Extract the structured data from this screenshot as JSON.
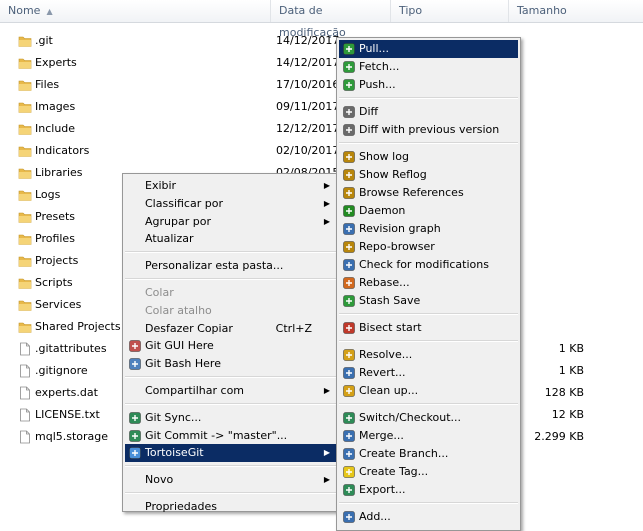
{
  "columns": {
    "name": "Nome",
    "date": "Data de modificação",
    "type": "Tipo",
    "size": "Tamanho"
  },
  "files": [
    {
      "name": ".git",
      "date": "14/12/2017",
      "type": "folder",
      "size": ""
    },
    {
      "name": "Experts",
      "date": "14/12/2017",
      "type": "folder",
      "size": ""
    },
    {
      "name": "Files",
      "date": "17/10/2016",
      "type": "folder",
      "size": ""
    },
    {
      "name": "Images",
      "date": "09/11/2017",
      "type": "folder",
      "size": ""
    },
    {
      "name": "Include",
      "date": "12/12/2017",
      "type": "folder",
      "size": ""
    },
    {
      "name": "Indicators",
      "date": "02/10/2017",
      "type": "folder",
      "size": ""
    },
    {
      "name": "Libraries",
      "date": "02/08/2015",
      "type": "folder",
      "size": ""
    },
    {
      "name": "Logs",
      "date": "",
      "type": "folder",
      "size": ""
    },
    {
      "name": "Presets",
      "date": "",
      "type": "folder",
      "size": ""
    },
    {
      "name": "Profiles",
      "date": "",
      "type": "folder",
      "size": ""
    },
    {
      "name": "Projects",
      "date": "",
      "type": "folder",
      "size": ""
    },
    {
      "name": "Scripts",
      "date": "",
      "type": "folder",
      "size": ""
    },
    {
      "name": "Services",
      "date": "",
      "type": "folder",
      "size": ""
    },
    {
      "name": "Shared Projects",
      "date": "",
      "type": "folder",
      "size": ""
    },
    {
      "name": ".gitattributes",
      "date": "",
      "type": "file",
      "size": "1 KB"
    },
    {
      "name": ".gitignore",
      "date": "",
      "type": "file",
      "size": "1 KB"
    },
    {
      "name": "experts.dat",
      "date": "",
      "type": "file",
      "size": "128 KB"
    },
    {
      "name": "LICENSE.txt",
      "date": "",
      "type": "file",
      "size": "12 KB"
    },
    {
      "name": "mql5.storage",
      "date": "",
      "type": "file",
      "size": "2.299 KB"
    }
  ],
  "context_menu": [
    {
      "label": "Exibir",
      "arrow": true
    },
    {
      "label": "Classificar por",
      "arrow": true
    },
    {
      "label": "Agrupar por",
      "arrow": true
    },
    {
      "label": "Atualizar"
    },
    {
      "sep": true
    },
    {
      "label": "Personalizar esta pasta..."
    },
    {
      "sep": true
    },
    {
      "label": "Colar",
      "disabled": true
    },
    {
      "label": "Colar atalho",
      "disabled": true
    },
    {
      "label": "Desfazer Copiar",
      "shortcut": "Ctrl+Z"
    },
    {
      "label": "Git GUI Here",
      "icon": "git-gui-icon"
    },
    {
      "label": "Git Bash Here",
      "icon": "git-bash-icon"
    },
    {
      "sep": true
    },
    {
      "label": "Compartilhar com",
      "arrow": true
    },
    {
      "sep": true
    },
    {
      "label": "Git Sync...",
      "icon": "git-sync-icon"
    },
    {
      "label": "Git Commit -> \"master\"...",
      "icon": "git-commit-icon"
    },
    {
      "label": "TortoiseGit",
      "icon": "tortoisegit-icon",
      "arrow": true,
      "highlight": true
    },
    {
      "sep": true
    },
    {
      "label": "Novo",
      "arrow": true
    },
    {
      "sep": true
    },
    {
      "label": "Propriedades"
    }
  ],
  "tortoise_menu": [
    {
      "label": "Pull...",
      "icon": "pull-icon",
      "highlight": true
    },
    {
      "label": "Fetch...",
      "icon": "fetch-icon"
    },
    {
      "label": "Push...",
      "icon": "push-icon"
    },
    {
      "sep": true
    },
    {
      "label": "Diff",
      "icon": "diff-icon"
    },
    {
      "label": "Diff with previous version",
      "icon": "diff-previous-icon"
    },
    {
      "sep": true
    },
    {
      "label": "Show log",
      "icon": "show-log-icon"
    },
    {
      "label": "Show Reflog",
      "icon": "show-reflog-icon"
    },
    {
      "label": "Browse References",
      "icon": "browse-references-icon"
    },
    {
      "label": "Daemon",
      "icon": "daemon-icon"
    },
    {
      "label": "Revision graph",
      "icon": "revision-graph-icon"
    },
    {
      "label": "Repo-browser",
      "icon": "repo-browser-icon"
    },
    {
      "label": "Check for modifications",
      "icon": "check-modifications-icon"
    },
    {
      "label": "Rebase...",
      "icon": "rebase-icon"
    },
    {
      "label": "Stash Save",
      "icon": "stash-save-icon"
    },
    {
      "sep": true
    },
    {
      "label": "Bisect start",
      "icon": "bisect-icon"
    },
    {
      "sep": true
    },
    {
      "label": "Resolve...",
      "icon": "resolve-icon"
    },
    {
      "label": "Revert...",
      "icon": "revert-icon"
    },
    {
      "label": "Clean up...",
      "icon": "cleanup-icon"
    },
    {
      "sep": true
    },
    {
      "label": "Switch/Checkout...",
      "icon": "switch-checkout-icon"
    },
    {
      "label": "Merge...",
      "icon": "merge-icon"
    },
    {
      "label": "Create Branch...",
      "icon": "create-branch-icon"
    },
    {
      "label": "Create Tag...",
      "icon": "create-tag-icon"
    },
    {
      "label": "Export...",
      "icon": "export-icon"
    },
    {
      "sep": true
    },
    {
      "label": "Add...",
      "icon": "add-icon"
    }
  ],
  "colors": {
    "highlight": "#0b2c64",
    "folder": "#e8b94a"
  }
}
